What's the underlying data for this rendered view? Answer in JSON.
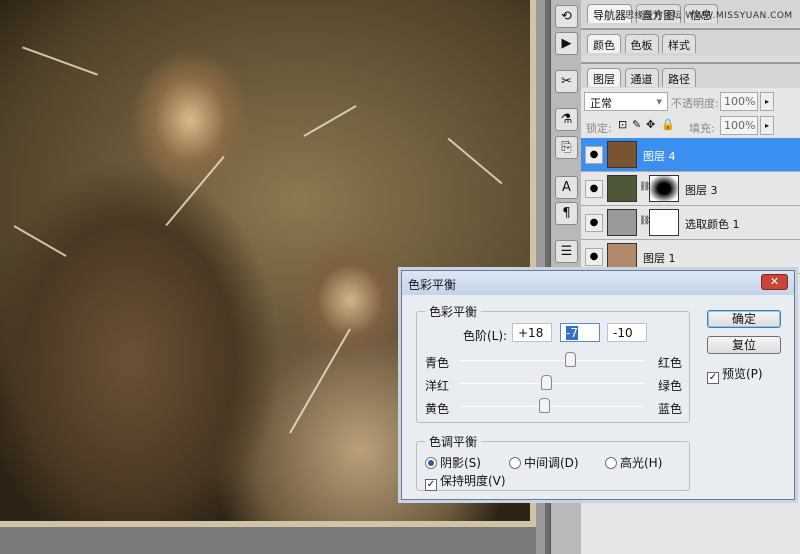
{
  "panels": {
    "group1_tabs": [
      "导航器",
      "直方图",
      "信息"
    ],
    "group2_tabs": [
      "颜色",
      "色板",
      "样式"
    ],
    "group3_tabs": [
      "图层",
      "通道",
      "路径"
    ],
    "watermark": "思缘设计论坛 WWW.MISSYUAN.COM",
    "blend_mode": "正常",
    "opacity_label": "不透明度:",
    "opacity_value": "100%",
    "lock_label": "锁定:",
    "fill_label": "填充:",
    "fill_value": "100%",
    "layers": [
      {
        "name": "图层 4",
        "selected": true
      },
      {
        "name": "图层 3"
      },
      {
        "name": "选取颜色 1"
      },
      {
        "name": "图层 1"
      }
    ]
  },
  "dialog": {
    "title": "色彩平衡",
    "group1": "色彩平衡",
    "levels_label": "色阶(L):",
    "levels": [
      "+18",
      "-7",
      "-10"
    ],
    "sliders": [
      {
        "left": "青色",
        "right": "红色",
        "value": 18
      },
      {
        "left": "洋红",
        "right": "绿色",
        "value": -7
      },
      {
        "left": "黄色",
        "right": "蓝色",
        "value": -10
      }
    ],
    "group2": "色调平衡",
    "tones": [
      "阴影(S)",
      "中间调(D)",
      "高光(H)"
    ],
    "tone_selected": "阴影(S)",
    "preserve": "保持明度(V)",
    "ok": "确定",
    "reset": "复位",
    "preview": "预览(P)"
  }
}
